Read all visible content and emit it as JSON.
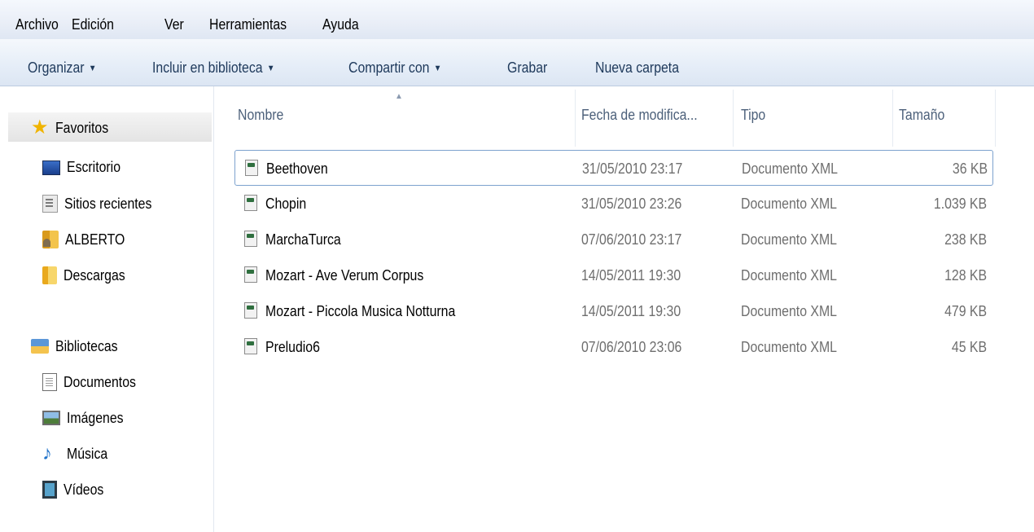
{
  "menu": [
    "Archivo",
    "Edición",
    "Ver",
    "Herramientas",
    "Ayuda"
  ],
  "toolbar": {
    "organize": "Organizar",
    "include_library": "Incluir en biblioteca",
    "share_with": "Compartir con",
    "burn": "Grabar",
    "new_folder": "Nueva carpeta"
  },
  "sidebar": {
    "favorites_header": "Favoritos",
    "favorites": [
      "Escritorio",
      "Sitios recientes",
      "ALBERTO",
      "Descargas"
    ],
    "libraries_header": "Bibliotecas",
    "libraries": [
      "Documentos",
      "Imágenes",
      "Música",
      "Vídeos"
    ]
  },
  "columns": [
    "Nombre",
    "Fecha de modifica...",
    "Tipo",
    "Tamaño"
  ],
  "files": [
    {
      "name": "Beethoven",
      "date": "31/05/2010 23:17",
      "type": "Documento XML",
      "size": "36 KB"
    },
    {
      "name": "Chopin",
      "date": "31/05/2010 23:26",
      "type": "Documento XML",
      "size": "1.039 KB"
    },
    {
      "name": "MarchaTurca",
      "date": "07/06/2010 23:17",
      "type": "Documento XML",
      "size": "238 KB"
    },
    {
      "name": "Mozart - Ave Verum Corpus",
      "date": "14/05/2011 19:30",
      "type": "Documento XML",
      "size": "128 KB"
    },
    {
      "name": "Mozart - Piccola Musica Notturna",
      "date": "14/05/2011 19:30",
      "type": "Documento XML",
      "size": "479 KB"
    },
    {
      "name": "Preludio6",
      "date": "07/06/2010 23:06",
      "type": "Documento XML",
      "size": "45 KB"
    }
  ]
}
